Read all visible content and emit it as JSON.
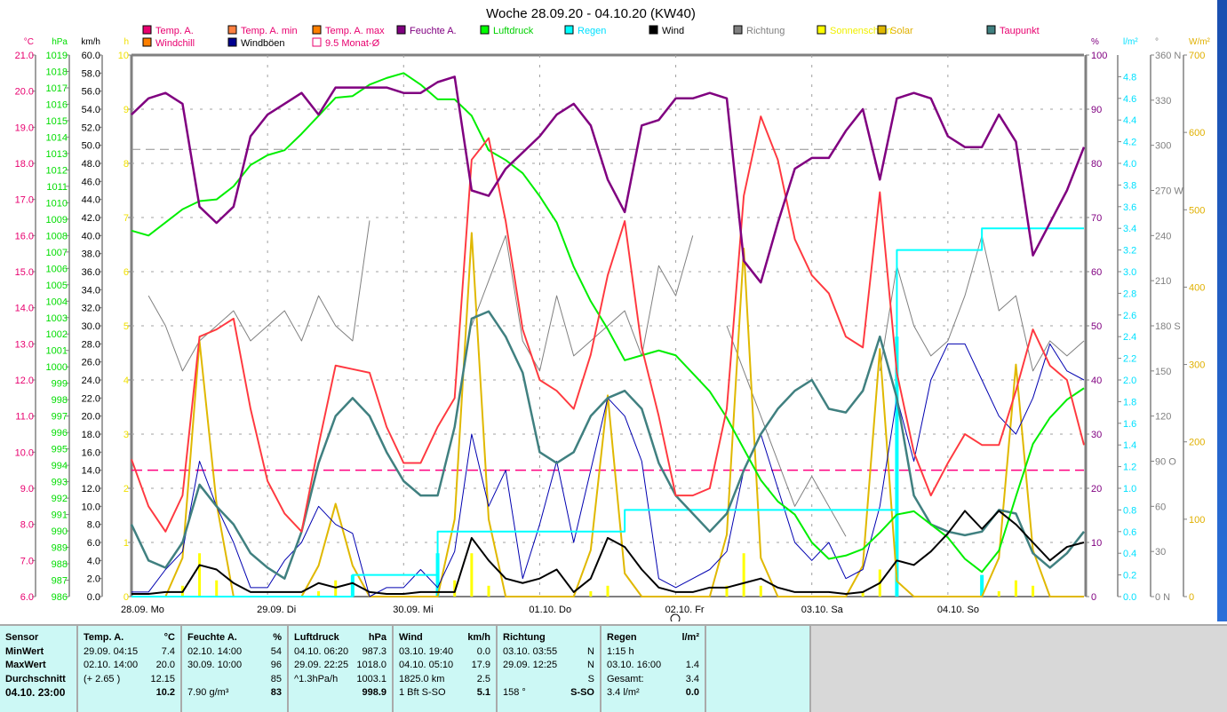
{
  "chart_data": {
    "type": "line",
    "title": "Woche 28.09.20 - 04.10.20 (KW40)",
    "x_step_hours": 3,
    "days": [
      "28.09.  Mo",
      "29.09.  Di",
      "30.09.  Mi",
      "01.10.  Do",
      "02.10.  Fr",
      "03.10.  Sa",
      "04.10.  So"
    ],
    "axes": {
      "temp": {
        "unit": "°C",
        "range": [
          6,
          21
        ],
        "ticks": [
          "6.0",
          "7.0",
          "8.0",
          "9.0",
          "10.0",
          "11.0",
          "12.0",
          "13.0",
          "14.0",
          "15.0",
          "16.0",
          "17.0",
          "18.0",
          "19.0",
          "20.0",
          "21.0"
        ]
      },
      "pressure": {
        "unit": "hPa",
        "range": [
          986,
          1019
        ],
        "ticks": [
          "986",
          "987",
          "988",
          "989",
          "990",
          "991",
          "992",
          "993",
          "994",
          "995",
          "996",
          "997",
          "998",
          "999",
          "1000",
          "1001",
          "1002",
          "1003",
          "1004",
          "1005",
          "1006",
          "1007",
          "1008",
          "1009",
          "1010",
          "1011",
          "1012",
          "1013",
          "1014",
          "1015",
          "1016",
          "1017",
          "1018",
          "1019"
        ]
      },
      "wind": {
        "unit": "km/h",
        "range": [
          0,
          60
        ],
        "ticks": [
          "0.0",
          "2.0",
          "4.0",
          "6.0",
          "8.0",
          "10.0",
          "12.0",
          "14.0",
          "16.0",
          "18.0",
          "20.0",
          "22.0",
          "24.0",
          "26.0",
          "28.0",
          "30.0",
          "32.0",
          "34.0",
          "36.0",
          "38.0",
          "40.0",
          "42.0",
          "44.0",
          "46.0",
          "48.0",
          "50.0",
          "52.0",
          "54.0",
          "56.0",
          "58.0",
          "60.0"
        ]
      },
      "sun": {
        "unit": "h",
        "range": [
          0,
          10
        ],
        "ticks": [
          "0",
          "1",
          "2",
          "3",
          "4",
          "5",
          "6",
          "7",
          "8",
          "9",
          "10"
        ]
      },
      "humidity": {
        "unit": "%",
        "range": [
          0,
          100
        ],
        "ticks": [
          "0",
          "10",
          "20",
          "30",
          "40",
          "50",
          "60",
          "70",
          "80",
          "90",
          "100"
        ]
      },
      "rain": {
        "unit": "l/m²",
        "range": [
          0,
          5
        ],
        "ticks": [
          "0.0",
          "0.2",
          "0.4",
          "0.6",
          "0.8",
          "1.0",
          "1.2",
          "1.4",
          "1.6",
          "1.8",
          "2.0",
          "2.2",
          "2.4",
          "2.6",
          "2.8",
          "3.0",
          "3.2",
          "3.4",
          "3.6",
          "3.8",
          "4.0",
          "4.2",
          "4.4",
          "4.6",
          "4.8"
        ]
      },
      "direction": {
        "unit": "°",
        "range": [
          0,
          360
        ],
        "ticks": [
          "0  N",
          "30",
          "60",
          "90  O",
          "120",
          "150",
          "180  S",
          "210",
          "240",
          "270  W",
          "300",
          "330",
          "360  N"
        ]
      },
      "solar": {
        "unit": "W/m²",
        "range": [
          0,
          700
        ],
        "ticks": [
          "0",
          "100",
          "200",
          "300",
          "400",
          "500",
          "600",
          "700"
        ]
      }
    },
    "legend": [
      {
        "label": "Temp. A.",
        "color": "#e8006f",
        "text": "#e8006f"
      },
      {
        "label": "Temp. A. min",
        "color": "#ff8040",
        "text": "#e8006f"
      },
      {
        "label": "Temp. A. max",
        "color": "#ff8000",
        "text": "#e8006f"
      },
      {
        "label": "Feuchte A.",
        "color": "#800080",
        "text": "#800080"
      },
      {
        "label": "Luftdruck",
        "color": "#00ff00",
        "text": "#00d000"
      },
      {
        "label": "Regen",
        "color": "#00ffff",
        "text": "#00e0ff"
      },
      {
        "label": "Wind",
        "color": "#000000",
        "text": "#000"
      },
      {
        "label": "Richtung",
        "color": "#808080",
        "text": "#808080"
      },
      {
        "label": "Sonnenschein",
        "color": "#ffff00",
        "text": "#f0f000"
      },
      {
        "label": "Solar",
        "color": "#e0b800",
        "text": "#e0b000"
      },
      {
        "label": "Taupunkt",
        "color": "#408080",
        "text": "#e8006f"
      },
      {
        "label": "Windchill",
        "color": "#ff8000",
        "text": "#e8006f"
      },
      {
        "label": "Windböen",
        "color": "#000090",
        "text": "#000"
      },
      {
        "label": "9.5 Monat-Ø",
        "color": "none",
        "text": "#e8006f"
      }
    ],
    "month_avg_temp": 9.5,
    "ref_pressure": 1013.25,
    "series": {
      "temp": [
        9.8,
        8.5,
        7.8,
        8.8,
        13.2,
        13.4,
        13.7,
        11.2,
        9.2,
        8.3,
        7.8,
        10.2,
        12.4,
        12.3,
        12.2,
        10.7,
        9.7,
        9.7,
        10.7,
        11.5,
        18.1,
        18.7,
        16.4,
        13.4,
        12.0,
        11.7,
        11.2,
        12.7,
        14.9,
        16.4,
        12.9,
        11.0,
        8.8,
        8.8,
        9.0,
        11.2,
        17.1,
        19.3,
        18.1,
        15.9,
        14.9,
        14.4,
        13.2,
        12.9,
        17.2,
        12.2,
        10.0,
        8.8,
        9.7,
        10.5,
        10.2,
        10.2,
        11.7,
        13.4,
        12.4,
        12.0,
        10.2
      ],
      "humidity": [
        89,
        92,
        93,
        91,
        72,
        69,
        72,
        85,
        89,
        91,
        93,
        89,
        94,
        94,
        94,
        94,
        93,
        93,
        95,
        96,
        75,
        74,
        79,
        82,
        85,
        89,
        91,
        87,
        77,
        71,
        87,
        88,
        92,
        92,
        93,
        92,
        62,
        58,
        69,
        79,
        81,
        81,
        86,
        90,
        77,
        92,
        93,
        92,
        85,
        83,
        83,
        89,
        84,
        63,
        69,
        75,
        83
      ],
      "pressure": [
        1008.3,
        1008.0,
        1008.8,
        1009.6,
        1010.1,
        1010.2,
        1011.0,
        1012.3,
        1012.9,
        1013.2,
        1014.2,
        1015.3,
        1016.4,
        1016.5,
        1017.2,
        1017.6,
        1017.9,
        1017.2,
        1016.3,
        1016.3,
        1015.3,
        1013.2,
        1012.6,
        1011.8,
        1010.4,
        1008.8,
        1006.1,
        1004.0,
        1002.3,
        1000.4,
        1000.7,
        1001.0,
        1000.7,
        999.6,
        998.5,
        996.9,
        995.0,
        993.1,
        991.8,
        991.0,
        989.3,
        988.3,
        988.5,
        988.9,
        989.9,
        991.0,
        991.2,
        990.4,
        989.6,
        988.3,
        987.5,
        988.8,
        992.1,
        995.3,
        996.9,
        998.0,
        998.7
      ],
      "dewpoint": [
        8.0,
        7.0,
        6.8,
        7.5,
        9.1,
        8.5,
        8.0,
        7.2,
        6.8,
        6.5,
        7.8,
        9.7,
        11.0,
        11.5,
        11.0,
        10.0,
        9.2,
        8.8,
        8.8,
        10.7,
        13.7,
        13.9,
        13.2,
        12.2,
        10.0,
        9.7,
        10.0,
        11.0,
        11.5,
        11.7,
        11.2,
        9.7,
        8.8,
        8.3,
        7.8,
        8.3,
        9.5,
        10.5,
        11.2,
        11.7,
        12.0,
        11.2,
        11.1,
        11.7,
        13.2,
        11.5,
        8.8,
        8.0,
        7.8,
        7.7,
        7.8,
        8.4,
        8.3,
        7.2,
        6.8,
        7.2,
        7.8
      ],
      "wind": [
        0.3,
        0.3,
        0.5,
        0.5,
        3.5,
        3,
        1.5,
        0.5,
        0.5,
        0.5,
        0.5,
        1.5,
        1,
        1.5,
        0.5,
        0.3,
        0.3,
        0.5,
        0.5,
        0.5,
        6.5,
        4,
        2,
        1.5,
        2,
        3,
        0.5,
        2,
        6.5,
        5.5,
        3,
        1,
        0.5,
        0.5,
        1,
        1,
        1.5,
        2,
        1,
        0.5,
        0.5,
        0.5,
        0.3,
        0.5,
        1.5,
        4,
        3.5,
        5,
        7,
        9.5,
        7.5,
        9.5,
        8,
        6,
        4,
        5.5,
        6
      ],
      "gusts": [
        0.5,
        0.5,
        3,
        5,
        15,
        10,
        6,
        1,
        1,
        4,
        6,
        10,
        8,
        7,
        0,
        1,
        1,
        3,
        1,
        5,
        18,
        10,
        14,
        2,
        8,
        15,
        6,
        14,
        22,
        20,
        15,
        2,
        1,
        2,
        3,
        5,
        14,
        18,
        12,
        6,
        4,
        6,
        2,
        3,
        10,
        22,
        15,
        24,
        28,
        28,
        24,
        20,
        18,
        22,
        28,
        25,
        24
      ],
      "direction": [
        null,
        200,
        180,
        150,
        170,
        180,
        190,
        170,
        180,
        190,
        170,
        200,
        180,
        170,
        250,
        null,
        null,
        null,
        null,
        null,
        180,
        210,
        240,
        170,
        150,
        200,
        160,
        170,
        180,
        190,
        160,
        220,
        200,
        240,
        null,
        180,
        150,
        120,
        90,
        60,
        80,
        60,
        40,
        null,
        150,
        220,
        180,
        160,
        170,
        200,
        240,
        190,
        200,
        150,
        170,
        160,
        170
      ],
      "solar": [
        0,
        0,
        0,
        50,
        330,
        120,
        0,
        0,
        0,
        0,
        0,
        40,
        120,
        40,
        0,
        0,
        0,
        0,
        0,
        100,
        470,
        100,
        0,
        0,
        0,
        0,
        0,
        60,
        260,
        30,
        0,
        0,
        0,
        0,
        0,
        80,
        450,
        50,
        0,
        0,
        0,
        0,
        0,
        40,
        320,
        20,
        0,
        0,
        0,
        0,
        0,
        50,
        300,
        60,
        0,
        0,
        0
      ],
      "sunshine": [
        0,
        0,
        0,
        0.2,
        0.8,
        0.3,
        0,
        0,
        0,
        0,
        0,
        0.1,
        0.3,
        0.1,
        0,
        0,
        0,
        0,
        0,
        0.3,
        0.8,
        0.2,
        0,
        0,
        0,
        0,
        0,
        0.1,
        0.2,
        0,
        0,
        0,
        0,
        0,
        0,
        0.2,
        0.8,
        0.2,
        0,
        0,
        0,
        0,
        0,
        0.1,
        0.5,
        0,
        0,
        0,
        0,
        0,
        0,
        0.1,
        0.3,
        0.2,
        0,
        0,
        0
      ],
      "rain_cumulative": [
        0,
        0,
        0,
        0,
        0,
        0,
        0,
        0,
        0,
        0,
        0,
        0,
        0,
        0.2,
        0.2,
        0.2,
        0.2,
        0.2,
        0.6,
        0.6,
        0.6,
        0.6,
        0.6,
        0.6,
        0.6,
        0.6,
        0.6,
        0.6,
        0.6,
        0.8,
        0.8,
        0.8,
        0.8,
        0.8,
        0.8,
        0.8,
        0.8,
        0.8,
        0.8,
        0.8,
        0.8,
        0.8,
        0.8,
        0.8,
        0.8,
        3.2,
        3.2,
        3.2,
        3.2,
        3.2,
        3.4,
        3.4,
        3.4,
        3.4,
        3.4,
        3.4,
        3.4
      ]
    }
  },
  "table": {
    "sensor": {
      "header": "Sensor",
      "min": "MinWert",
      "max": "MaxWert",
      "avg": "Durchschnitt",
      "now": "04.10. 23:00"
    },
    "columns": [
      {
        "title": "Temp. A.",
        "unit": "°C",
        "rows": [
          [
            "29.09.  04:15",
            "7.4"
          ],
          [
            "02.10.  14:00",
            "20.0"
          ],
          [
            "(+ 2.65 )",
            "12.15"
          ],
          [
            "",
            "10.2"
          ]
        ]
      },
      {
        "title": "Feuchte A.",
        "unit": "%",
        "rows": [
          [
            "02.10.  14:00",
            "54"
          ],
          [
            "30.09.  10:00",
            "96"
          ],
          [
            "",
            "85"
          ],
          [
            "7.90 g/m³",
            "83"
          ]
        ]
      },
      {
        "title": "Luftdruck",
        "unit": "hPa",
        "rows": [
          [
            "04.10.  06:20",
            "987.3"
          ],
          [
            "29.09.  22:25",
            "1018.0"
          ],
          [
            "^1.3hPa/h",
            "1003.1"
          ],
          [
            "",
            "998.9"
          ]
        ]
      },
      {
        "title": "Wind",
        "unit": "km/h",
        "rows": [
          [
            "03.10.  19:40",
            "0.0"
          ],
          [
            "04.10.  05:10",
            "17.9"
          ],
          [
            "1825.0 km",
            "2.5"
          ],
          [
            "1 Bft S-SO",
            "5.1"
          ]
        ]
      },
      {
        "title": "Richtung",
        "unit": "",
        "rows": [
          [
            "03.10.  03:55",
            "N"
          ],
          [
            "29.09.  12:25",
            "N"
          ],
          [
            "",
            "S"
          ],
          [
            "158 °",
            "S-SO"
          ]
        ]
      },
      {
        "title": "Regen",
        "unit": "l/m²",
        "rows": [
          [
            "1:15 h",
            ""
          ],
          [
            "03.10.  16:00",
            "1.4"
          ],
          [
            "Gesamt:",
            "3.4"
          ],
          [
            "3.4 l/m²",
            "0.0"
          ]
        ]
      }
    ]
  }
}
